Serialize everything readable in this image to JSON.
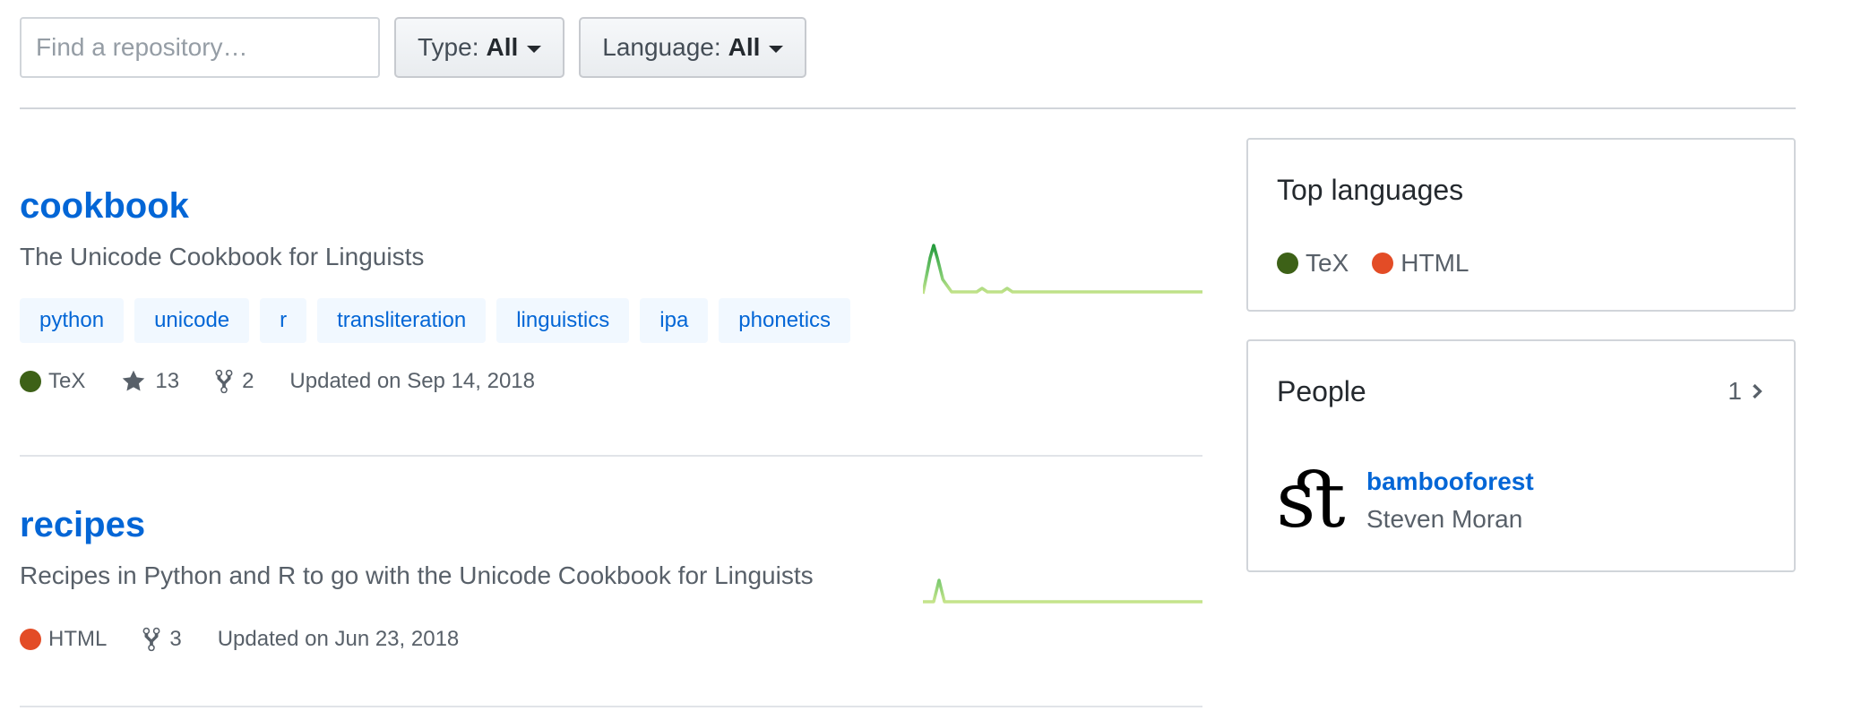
{
  "filters": {
    "search_placeholder": "Find a repository…",
    "type": {
      "label": "Type:",
      "value": "All"
    },
    "language": {
      "label": "Language:",
      "value": "All"
    }
  },
  "repos": [
    {
      "name": "cookbook",
      "description": "The Unicode Cookbook for Linguists",
      "topics": [
        "python",
        "unicode",
        "r",
        "transliteration",
        "linguistics",
        "ipa",
        "phonetics"
      ],
      "language": "TeX",
      "language_color": "#3d6117",
      "stars": "13",
      "forks": "2",
      "updated": "Updated on Sep 14, 2018"
    },
    {
      "name": "recipes",
      "description": "Recipes in Python and R to go with the Unicode Cookbook for Linguists",
      "topics": [],
      "language": "HTML",
      "language_color": "#e34c26",
      "forks": "3",
      "updated": "Updated on Jun 23, 2018"
    }
  ],
  "sidebar": {
    "top_languages": {
      "title": "Top languages",
      "items": [
        {
          "name": "TeX",
          "color": "#3d6117"
        },
        {
          "name": "HTML",
          "color": "#e34c26"
        }
      ]
    },
    "people": {
      "title": "People",
      "count": "1",
      "members": [
        {
          "login": "bambooforest",
          "name": "Steven Moran",
          "avatar_glyph": "ﬆ"
        }
      ]
    }
  },
  "colors": {
    "link": "#0366d6",
    "sparkline_light": "#c6e48b",
    "sparkline_dark": "#239a3b"
  }
}
